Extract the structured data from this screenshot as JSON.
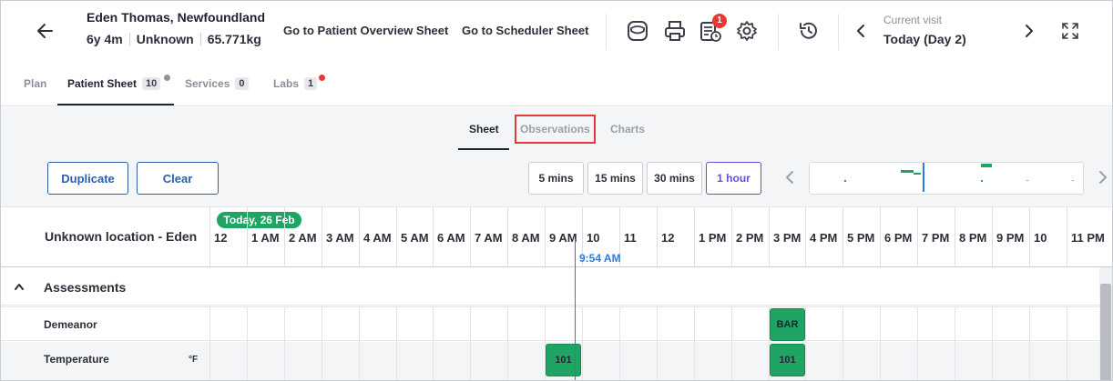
{
  "header": {
    "patient_name": "Eden Thomas, Newfoundland",
    "age": "6y 4m",
    "sex": "Unknown",
    "weight": "65.771kg",
    "link_overview": "Go to Patient Overview Sheet",
    "link_scheduler": "Go to Scheduler Sheet",
    "notification_count": "1",
    "visit_label": "Current visit",
    "visit_value": "Today (Day 2)",
    "icons": [
      "back-arrow-icon",
      "sticker-icon",
      "print-icon",
      "checklist-clock-icon",
      "gear-icon",
      "history-icon",
      "chevron-left-icon",
      "chevron-right-icon",
      "expand-icon"
    ]
  },
  "tabs": [
    {
      "label": "Plan",
      "count": ""
    },
    {
      "label": "Patient Sheet",
      "count": "10"
    },
    {
      "label": "Services",
      "count": "0"
    },
    {
      "label": "Labs",
      "count": "1"
    }
  ],
  "subtabs": [
    "Sheet",
    "Observations",
    "Charts"
  ],
  "toolbar": {
    "duplicate": "Duplicate",
    "clear": "Clear",
    "intervals": [
      "5 mins",
      "15 mins",
      "30 mins",
      "1 hour"
    ],
    "selected_interval": "1 hour"
  },
  "timeline": {
    "location": "Unknown location - Eden",
    "date_pill": "Today, 26 Feb",
    "hours": [
      "12",
      "1 AM",
      "2 AM",
      "3 AM",
      "4 AM",
      "5 AM",
      "6 AM",
      "7 AM",
      "8 AM",
      "9 AM",
      "10",
      "11",
      "12",
      "1 PM",
      "2 PM",
      "3 PM",
      "4 PM",
      "5 PM",
      "6 PM",
      "7 PM",
      "8 PM",
      "9 PM",
      "10",
      "11 PM"
    ],
    "now_label": "9:54 AM"
  },
  "grid": {
    "section": "Assessments",
    "rows": [
      {
        "label": "Demeanor",
        "unit": "",
        "entries": [
          {
            "hour": "3 PM",
            "value": "BAR"
          }
        ]
      },
      {
        "label": "Temperature",
        "unit": "°F",
        "entries": [
          {
            "hour": "9 AM",
            "value": "101"
          },
          {
            "hour": "3 PM",
            "value": "101"
          }
        ]
      }
    ]
  },
  "colors": {
    "accent_blue": "#2c5fa8",
    "selected_purple": "#6a4bd6",
    "chip_green": "#1fa463",
    "alert_red": "#e53935",
    "now_blue": "#2c7be5"
  }
}
